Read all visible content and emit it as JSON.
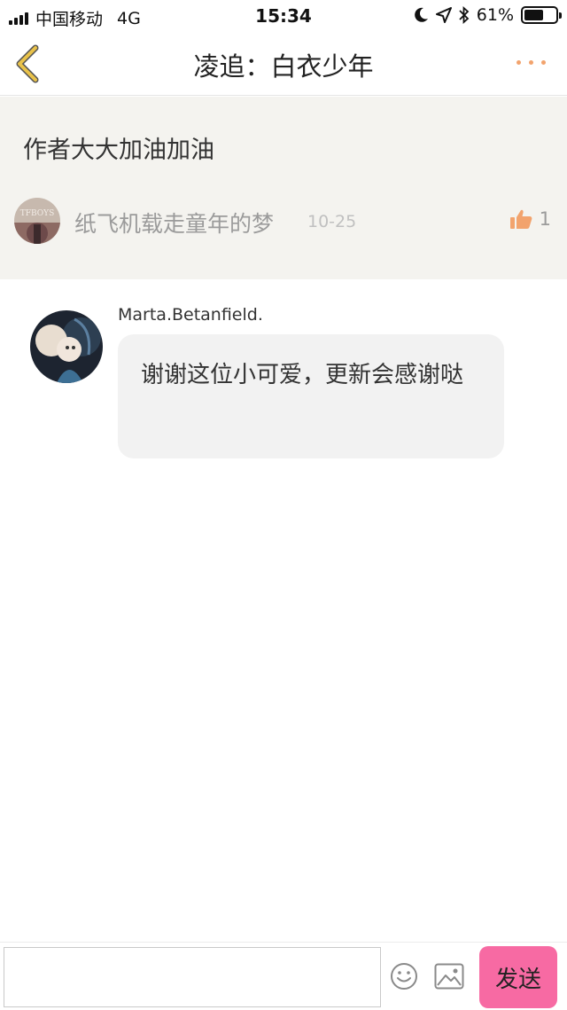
{
  "status_bar": {
    "carrier": "中国移动",
    "network": "4G",
    "time": "15:34",
    "battery_percent_label": "61%",
    "battery_level": 0.61
  },
  "nav": {
    "title": "凌追：白衣少年"
  },
  "original_comment": {
    "text": "作者大大加油加油",
    "author": "纸飞机载走童年的梦",
    "date": "10-25",
    "like_count": "1",
    "avatar_text": "TFBOYS"
  },
  "reply": {
    "author": "Marta.Betanfield.",
    "text": "谢谢这位小可爱，更新会感谢哒"
  },
  "input_bar": {
    "placeholder": "",
    "send_label": "发送"
  },
  "colors": {
    "accent": "#f2a36d",
    "send_button": "#f76aa3",
    "comment_bg": "#f4f3ef",
    "bubble_bg": "#f2f2f2",
    "back_arrow": "#e9c24a"
  },
  "icons": {
    "back": "chevron-left-icon",
    "more": "more-dots-icon",
    "like": "thumbs-up-icon",
    "emoji": "smiley-icon",
    "image": "image-icon"
  }
}
